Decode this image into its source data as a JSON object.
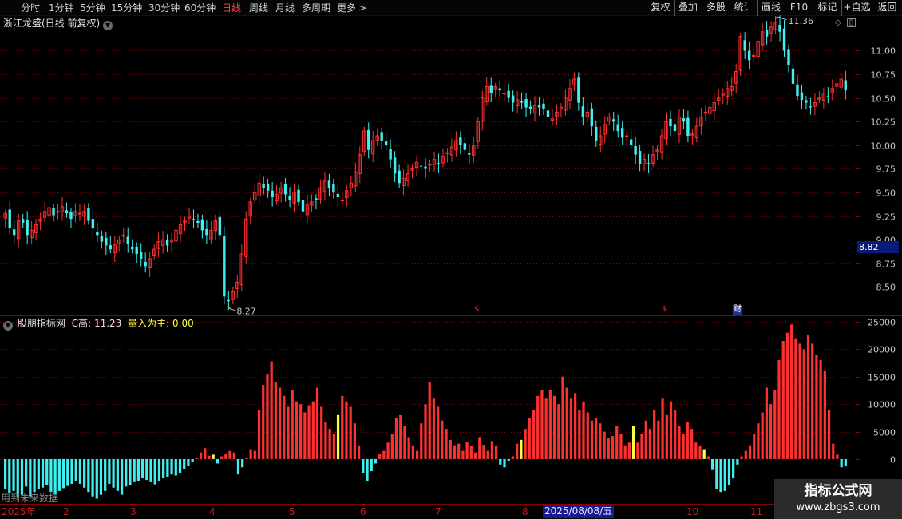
{
  "toolbar": {
    "periods": [
      "分时",
      "1分钟",
      "5分钟",
      "15分钟",
      "30分钟",
      "60分钟",
      "日线",
      "周线",
      "月线",
      "多周期",
      "更多"
    ],
    "more_arrow": ">",
    "buttons": [
      "复权",
      "叠加",
      "多股",
      "统计",
      "画线",
      "F10",
      "标记",
      "+自选",
      "返回"
    ]
  },
  "main_panel": {
    "title": "浙江龙盛(日线 前复权)",
    "high_annotation": "11.36",
    "low_annotation": "8.27",
    "current_price_tag": "8.82",
    "event_markers": [
      "$",
      "$",
      "财"
    ]
  },
  "indicator_panel": {
    "name": "股朋指标网",
    "c_high_label": "C高:",
    "c_high_value": "11.23",
    "volume_label": "量入为主:",
    "volume_value": "0.00"
  },
  "dates": {
    "year_label": "2025年",
    "month_labels": [
      "2",
      "3",
      "4",
      "5",
      "6",
      "7",
      "8",
      "10",
      "11"
    ],
    "cursor_date": "2025/08/08/五"
  },
  "future_note": "用到未来数据",
  "watermark": {
    "line1": "指标公式网",
    "line2": "www.zbgs3.com"
  },
  "colors": {
    "up": "#ff3030",
    "down": "#40f0f0",
    "highlight": "#ffff40",
    "grid": "#8b0000",
    "background": "#000000"
  },
  "chart_data": [
    {
      "type": "candlestick",
      "title": "浙江龙盛(日线 前复权)",
      "ylim": [
        8.2,
        11.35
      ],
      "y_ticks": [
        8.5,
        8.75,
        9.0,
        9.25,
        9.5,
        9.75,
        10.0,
        10.25,
        10.5,
        10.75,
        11.0
      ],
      "y_tick_labels": [
        "8.50",
        "8.75",
        "9.00",
        "9.25",
        "9.50",
        "9.75",
        "10.00",
        "10.25",
        "10.50",
        "10.75",
        "11.00"
      ],
      "period_high": 11.36,
      "period_low": 8.27,
      "close": [
        9.28,
        9.12,
        9.05,
        9.2,
        9.18,
        9.05,
        9.1,
        9.16,
        9.22,
        9.3,
        9.34,
        9.26,
        9.3,
        9.35,
        9.28,
        9.22,
        9.3,
        9.28,
        9.3,
        9.2,
        9.12,
        9.05,
        8.98,
        8.94,
        8.9,
        8.95,
        9.0,
        9.05,
        8.96,
        8.9,
        8.85,
        8.8,
        8.72,
        8.8,
        8.9,
        8.98,
        9.0,
        8.94,
        9.0,
        9.1,
        9.16,
        9.2,
        9.25,
        9.22,
        9.18,
        9.1,
        9.05,
        9.1,
        9.2,
        9.05,
        8.4,
        8.35,
        8.45,
        8.55,
        8.85,
        9.22,
        9.4,
        9.5,
        9.6,
        9.55,
        9.52,
        9.45,
        9.48,
        9.55,
        9.48,
        9.42,
        9.5,
        9.4,
        9.3,
        9.38,
        9.4,
        9.42,
        9.55,
        9.62,
        9.55,
        9.5,
        9.45,
        9.42,
        9.52,
        9.6,
        9.72,
        9.9,
        10.15,
        9.95,
        10.05,
        10.1,
        10.05,
        10.0,
        9.85,
        9.7,
        9.6,
        9.65,
        9.7,
        9.75,
        9.82,
        9.78,
        9.75,
        9.8,
        9.85,
        9.8,
        9.88,
        9.92,
        9.98,
        10.05,
        10.0,
        9.95,
        9.9,
        10.0,
        10.25,
        10.5,
        10.62,
        10.55,
        10.62,
        10.58,
        10.55,
        10.5,
        10.45,
        10.48,
        10.45,
        10.4,
        10.38,
        10.42,
        10.4,
        10.38,
        10.3,
        10.28,
        10.35,
        10.4,
        10.5,
        10.6,
        10.7,
        10.45,
        10.3,
        10.35,
        10.2,
        10.05,
        10.1,
        10.22,
        10.3,
        10.25,
        10.15,
        10.08,
        10.1,
        10.0,
        9.9,
        9.8,
        9.85,
        9.8,
        9.9,
        9.95,
        10.1,
        10.25,
        10.2,
        10.15,
        10.3,
        10.25,
        10.1,
        10.12,
        10.2,
        10.3,
        10.35,
        10.4,
        10.45,
        10.5,
        10.55,
        10.6,
        10.62,
        10.78,
        11.15,
        11.0,
        10.9,
        10.95,
        11.1,
        11.2,
        11.15,
        11.25,
        11.3,
        11.2,
        11.0,
        10.85,
        10.65,
        10.52,
        10.48,
        10.45,
        10.4,
        10.45,
        10.5,
        10.55,
        10.52,
        10.6,
        10.65,
        10.7,
        10.58
      ]
    },
    {
      "type": "bar",
      "series_name": "量入为主",
      "ylim": [
        -8000,
        26000
      ],
      "y_ticks": [
        0,
        5000,
        10000,
        15000,
        20000,
        25000
      ],
      "y_tick_labels": [
        "0",
        "5000",
        "10000",
        "15000",
        "20000",
        "25000"
      ],
      "highlight_bar_indices": [
        50,
        80,
        124,
        151,
        168
      ],
      "values": [
        -5500,
        -6200,
        -5800,
        -7000,
        -6500,
        -5000,
        -6800,
        -6000,
        -5500,
        -5200,
        -4800,
        -6000,
        -6500,
        -5800,
        -5300,
        -4900,
        -4500,
        -4000,
        -4500,
        -5200,
        -6000,
        -6800,
        -7200,
        -6500,
        -5800,
        -4500,
        -5200,
        -5800,
        -6500,
        -5000,
        -4800,
        -4200,
        -4000,
        -3500,
        -3800,
        -4200,
        -4600,
        -4000,
        -3500,
        -3200,
        -2800,
        -3000,
        -2500,
        -1800,
        -1200,
        -500,
        300,
        1200,
        2000,
        600,
        800,
        -800,
        500,
        1000,
        1500,
        1200,
        -2800,
        -1500,
        300,
        1800,
        1500,
        9000,
        13500,
        15500,
        17800,
        14000,
        13000,
        11500,
        9500,
        12500,
        10500,
        10000,
        8500,
        9800,
        10500,
        13000,
        9500,
        6800,
        5500,
        4500,
        8000,
        11500,
        10500,
        9500,
        6500,
        2500,
        -2500,
        -4000,
        -2200,
        -800,
        1000,
        1500,
        3000,
        4500,
        7500,
        8000,
        6000,
        4000,
        2500,
        1500,
        6500,
        10000,
        14000,
        11000,
        9500,
        7000,
        5500,
        3500,
        2500,
        2800,
        1500,
        3200,
        2400,
        1200,
        4000,
        2600,
        1500,
        3300,
        2500,
        -1000,
        -1500,
        -300,
        500,
        2800,
        3500,
        5500,
        7500,
        9000,
        11500,
        12500,
        11000,
        12500,
        11500,
        10000,
        15000,
        13000,
        11000,
        12000,
        9000,
        10500,
        8500,
        7000,
        7500,
        6500,
        5000,
        3800,
        4200,
        6000,
        4500,
        2500,
        3000,
        6000,
        3000,
        4500,
        7000,
        5500,
        9000,
        7000,
        11000,
        8000,
        10500,
        9000,
        6000,
        4500,
        6800,
        5500,
        3000,
        2400,
        1800,
        500,
        -2000,
        -5500,
        -6000,
        -5800,
        -4800,
        -3500,
        -1000,
        500,
        1500,
        2500,
        4500,
        6500,
        8500,
        13000,
        10000,
        12500,
        18000,
        21500,
        23000,
        24500,
        22000,
        21000,
        20000,
        22500,
        21000,
        19000,
        18000,
        16000,
        9000,
        2800,
        800,
        -1500,
        -1200
      ]
    }
  ]
}
